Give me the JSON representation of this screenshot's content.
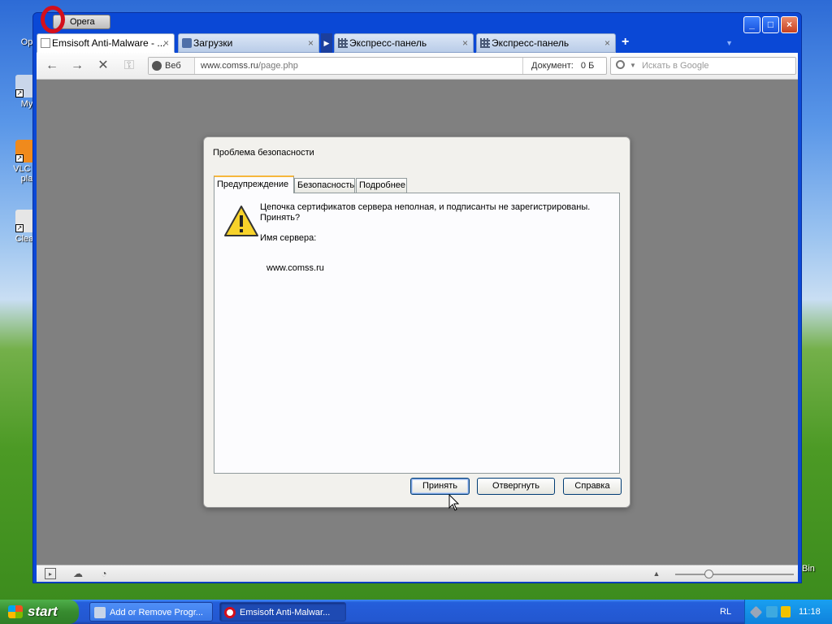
{
  "desktop": {
    "icons": [
      {
        "label": "Op"
      },
      {
        "label": "My"
      },
      {
        "label": "VLC m pla"
      },
      {
        "label": "Clean"
      }
    ],
    "right_label": "Bin"
  },
  "window": {
    "menu_button": "Opera",
    "controls": {
      "minimize": "_",
      "maximize": "□",
      "close": "×"
    },
    "tabs": [
      {
        "title": "Emsisoft Anti-Malware - ...",
        "close": "×"
      },
      {
        "title": "Загрузки",
        "close": "×"
      },
      {
        "title": "Экспресс-панель",
        "close": "×"
      },
      {
        "title": "Экспресс-панель",
        "close": "×"
      }
    ],
    "new_tab": "+"
  },
  "toolbar": {
    "back": "←",
    "forward": "→",
    "stop": "✕",
    "key": "⚿",
    "protocol_label": "Веб",
    "url_host": "www.comss.ru",
    "url_path": "/page.php",
    "document_label": "Документ:",
    "document_size": "0 Б",
    "search_placeholder": "Искать в Google"
  },
  "dialog": {
    "title": "Проблема безопасности",
    "tabs": [
      "Предупреждение",
      "Безопасность",
      "Подробнее"
    ],
    "message": "Цепочка сертификатов сервера неполная, и подписанты не зарегистрированы. Принять?",
    "server_label": "Имя сервера:",
    "server_value": "www.comss.ru",
    "buttons": {
      "accept": "Принять",
      "reject": "Отвергнуть",
      "help": "Справка"
    }
  },
  "statusbar": {
    "zoom_fraction": 0.28
  },
  "taskbar": {
    "start": "start",
    "items": [
      {
        "label": "Add or Remove Progr...",
        "active": false
      },
      {
        "label": "Emsisoft Anti-Malwar...",
        "active": true
      }
    ],
    "language": "RL",
    "clock": "11:18"
  },
  "colors": {
    "titlebar": "#0a48d6",
    "content_bg": "#808080",
    "tab_active_accent": "#f6b73c",
    "taskbar": "#245edb",
    "start_green": "#378b2f"
  }
}
